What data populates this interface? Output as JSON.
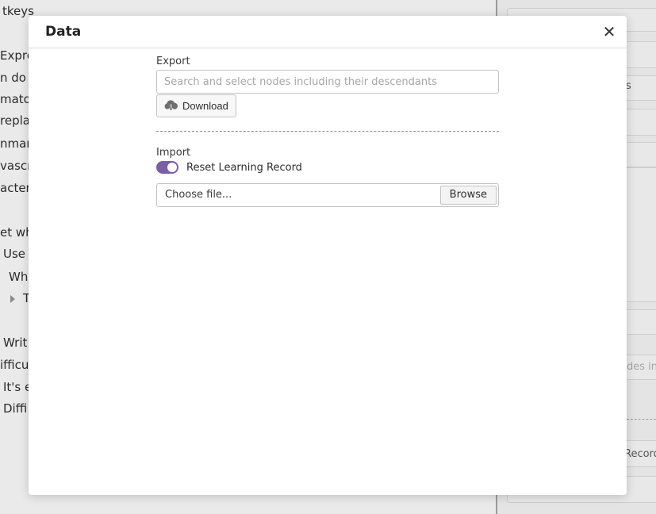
{
  "background": {
    "tree_lines": [
      "tkeys",
      "Expre",
      "n do",
      "mato",
      "repla",
      "nmar",
      "vascri",
      "acters",
      "et wh",
      "Use",
      "Wh",
      "T",
      "Writ",
      "ifficu",
      "It's e",
      "Diffi"
    ],
    "panel_fragments": {
      "s": "s",
      "placeholder": "des inc",
      "record": "Record"
    }
  },
  "dialog": {
    "title": "Data",
    "close_icon": "close-icon",
    "export": {
      "label": "Export",
      "search_placeholder": "Search and select nodes including their descendants",
      "search_value": "",
      "download_label": "Download",
      "download_icon": "cloud-download-icon"
    },
    "import": {
      "label": "Import",
      "toggle_label": "Reset Learning Record",
      "toggle_on": true,
      "file_placeholder": "Choose file...",
      "browse_label": "Browse"
    }
  },
  "colors": {
    "accent": "#7b5ea7",
    "modal_background": "#ffffff",
    "backdrop": "#eaeaea"
  }
}
